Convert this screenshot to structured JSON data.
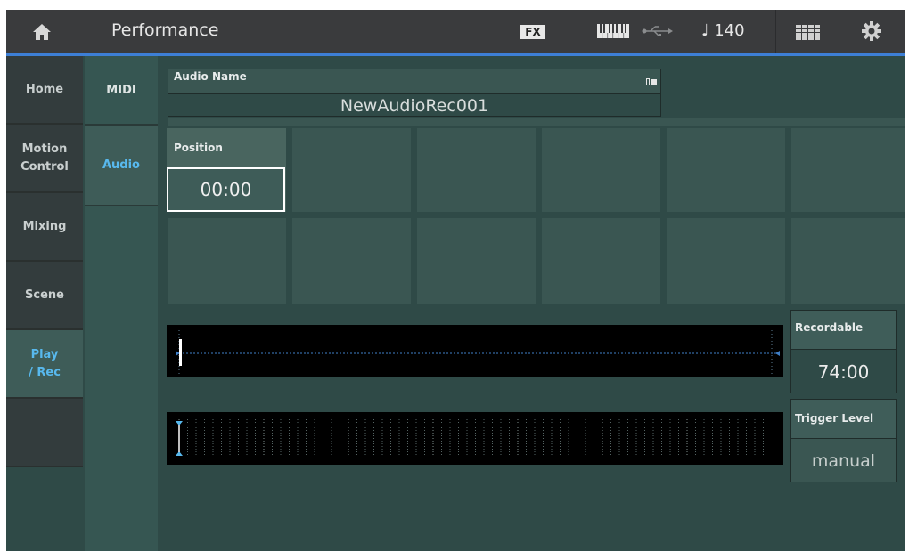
{
  "header": {
    "title": "Performance",
    "fx_label": "FX",
    "tempo_label": "♩ 140",
    "accent_color": "#3d7fd6"
  },
  "left_nav": [
    {
      "label": "Home",
      "active": false
    },
    {
      "label": "Motion\nControl",
      "active": false
    },
    {
      "label": "Mixing",
      "active": false
    },
    {
      "label": "Scene",
      "active": false
    },
    {
      "label": "Play\n/ Rec",
      "active": true
    },
    {
      "label": "",
      "active": false
    }
  ],
  "sub_nav": [
    {
      "label": "MIDI",
      "active": false
    },
    {
      "label": "Audio",
      "active": true
    }
  ],
  "audio_name": {
    "label": "Audio Name",
    "value": "NewAudioRec001"
  },
  "position": {
    "label": "Position",
    "value": "00:00"
  },
  "recordable": {
    "label": "Recordable",
    "value": "74:00"
  },
  "trigger_level": {
    "label": "Trigger Level",
    "value": "manual"
  },
  "icons": {
    "home": "home-icon",
    "keyboard": "keyboard-icon",
    "usb": "usb-icon",
    "grid": "grid-icon",
    "settings": "gear-icon"
  }
}
